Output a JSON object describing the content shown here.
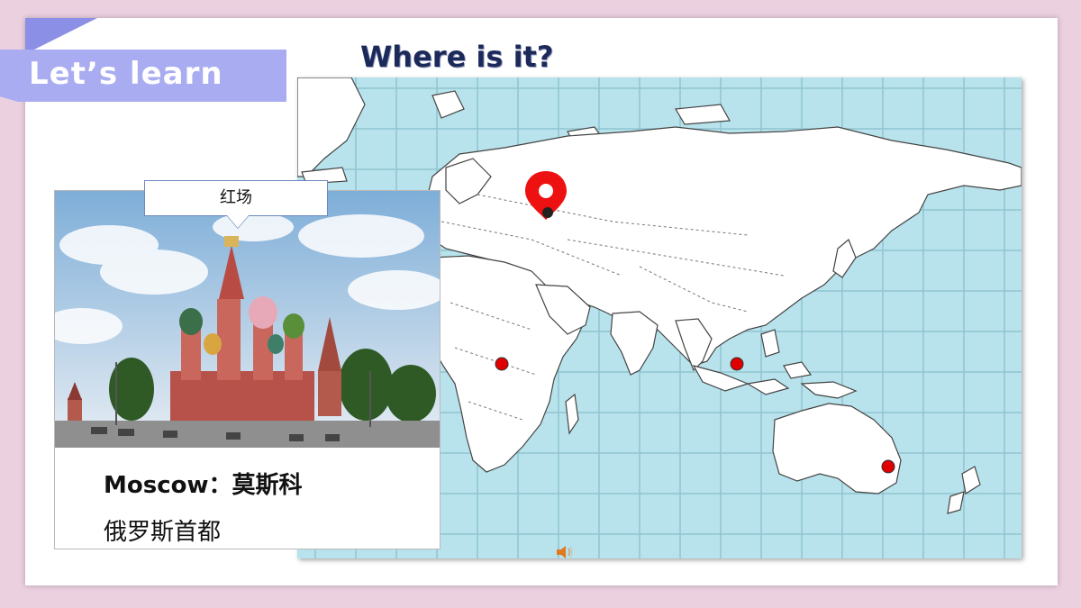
{
  "banner": {
    "label": "Let’s learn"
  },
  "heading": {
    "text": "Where is it?"
  },
  "photo": {
    "callout_label": "红场",
    "caption_line1": "Moscow：莫斯科",
    "caption_line2": "俄罗斯首都"
  },
  "map": {
    "ocean_color": "#b8e3ec",
    "land_color": "#ffffff",
    "marker_color": "#e00000",
    "selected_marker": "location-pin-icon"
  },
  "icons": {
    "audio": "speaker-icon"
  }
}
